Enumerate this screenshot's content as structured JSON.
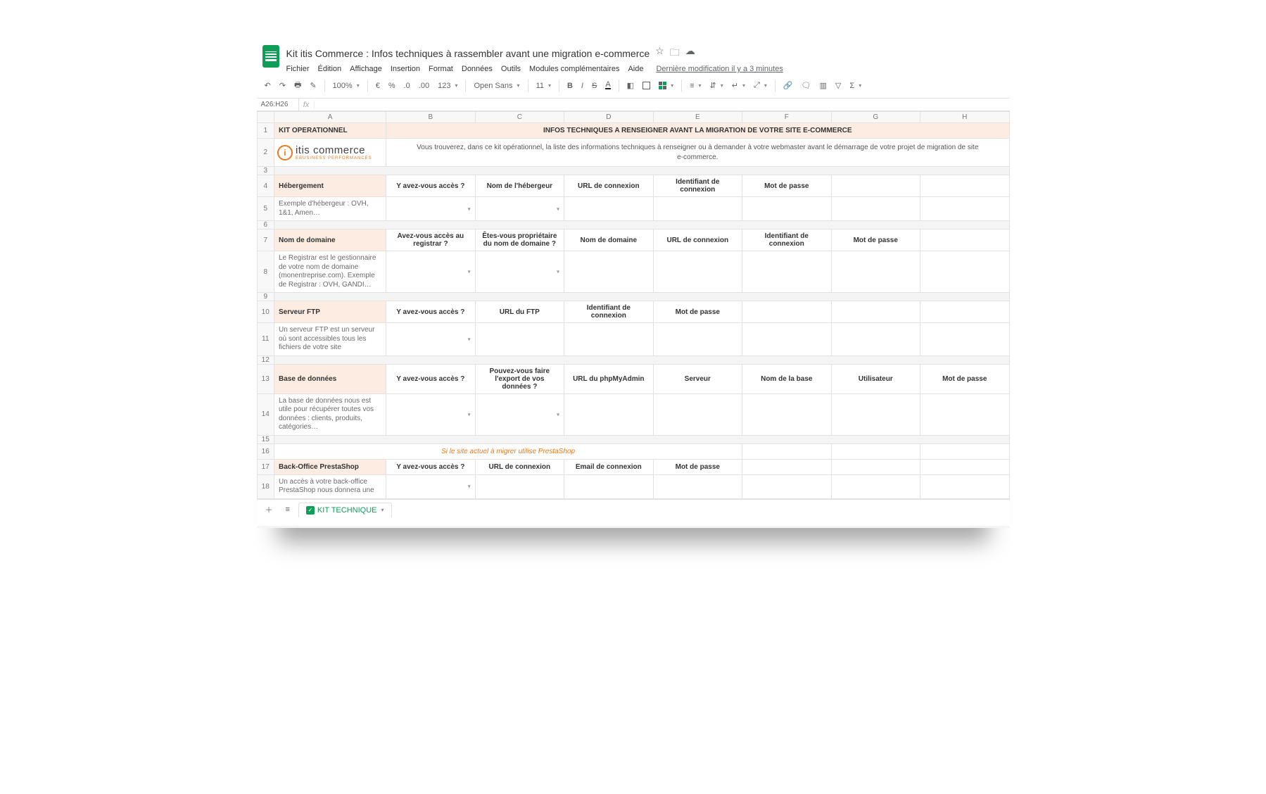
{
  "doc": {
    "title": "Kit itis Commerce : Infos techniques à rassembler avant une migration e-commerce",
    "last_modified": "Dernière modification il y a 3 minutes"
  },
  "menus": [
    "Fichier",
    "Édition",
    "Affichage",
    "Insertion",
    "Format",
    "Données",
    "Outils",
    "Modules complémentaires",
    "Aide"
  ],
  "toolbar": {
    "zoom": "100%",
    "currency": "€",
    "percent": "%",
    "dec_dec": ".0",
    "dec_inc": ".00",
    "more_formats": "123",
    "font": "Open Sans",
    "size": "11"
  },
  "namebox": "A26:H26",
  "fx_label": "fx",
  "cols": [
    "A",
    "B",
    "C",
    "D",
    "E",
    "F",
    "G",
    "H"
  ],
  "rows": {
    "r1": {
      "a": "KIT OPERATIONNEL",
      "bh": "INFOS TECHNIQUES A RENSEIGNER AVANT LA MIGRATION DE VOTRE SITE E-COMMERCE"
    },
    "r2": {
      "logo_main": "itis commerce",
      "logo_sub": "EBUSINESS PERFORMANCES",
      "intro": "Vous trouverez, dans ce kit opérationnel, la liste des informations techniques à renseigner ou à demander à votre webmaster avant le démarrage de votre projet de migration de site e-commerce."
    },
    "r4": {
      "a": "Hébergement",
      "b": "Y avez-vous accès ?",
      "c": "Nom de l'hébergeur",
      "d": "URL de connexion",
      "e": "Identifiant de connexion",
      "f": "Mot de passe"
    },
    "r5": {
      "a": "Exemple d'hébergeur : OVH, 1&1, Amen…"
    },
    "r7": {
      "a": "Nom de domaine",
      "b": "Avez-vous accès au registrar ?",
      "c": "Êtes-vous propriétaire du nom de domaine ?",
      "d": "Nom de domaine",
      "e": "URL de connexion",
      "f": "Identifiant de connexion",
      "g": "Mot de passe"
    },
    "r8": {
      "a": "Le Registrar est le gestionnaire de votre nom de domaine (monentreprise.com). Exemple de Registrar : OVH, GANDI…"
    },
    "r10": {
      "a": "Serveur FTP",
      "b": "Y avez-vous accès ?",
      "c": "URL du FTP",
      "d": "Identifiant de connexion",
      "e": "Mot de passe"
    },
    "r11": {
      "a": "Un serveur FTP est un serveur où sont accessibles tous les fichiers de votre site"
    },
    "r13": {
      "a": "Base de données",
      "b": "Y avez-vous accès ?",
      "c": "Pouvez-vous faire l'export de vos données ?",
      "d": "URL du phpMyAdmin",
      "e": "Serveur",
      "f": "Nom de la base",
      "g": "Utilisateur",
      "h": "Mot de passe"
    },
    "r14": {
      "a": "La base de données nous est utile pour récupérer toutes vos données : clients, produits, catégories…"
    },
    "r16": {
      "note": "Si le site actuel à migrer utilise PrestaShop"
    },
    "r17": {
      "a": "Back-Office PrestaShop",
      "b": "Y avez-vous accès ?",
      "c": "URL de connexion",
      "d": "Email de connexion",
      "e": "Mot de passe"
    },
    "r18": {
      "a": "Un accès à votre back-office PrestaShop nous donnera une"
    }
  },
  "sheet_tab": "KIT TECHNIQUE",
  "row_nums": [
    "1",
    "2",
    "3",
    "4",
    "5",
    "6",
    "7",
    "8",
    "9",
    "10",
    "11",
    "12",
    "13",
    "14",
    "15",
    "16",
    "17",
    "18"
  ]
}
